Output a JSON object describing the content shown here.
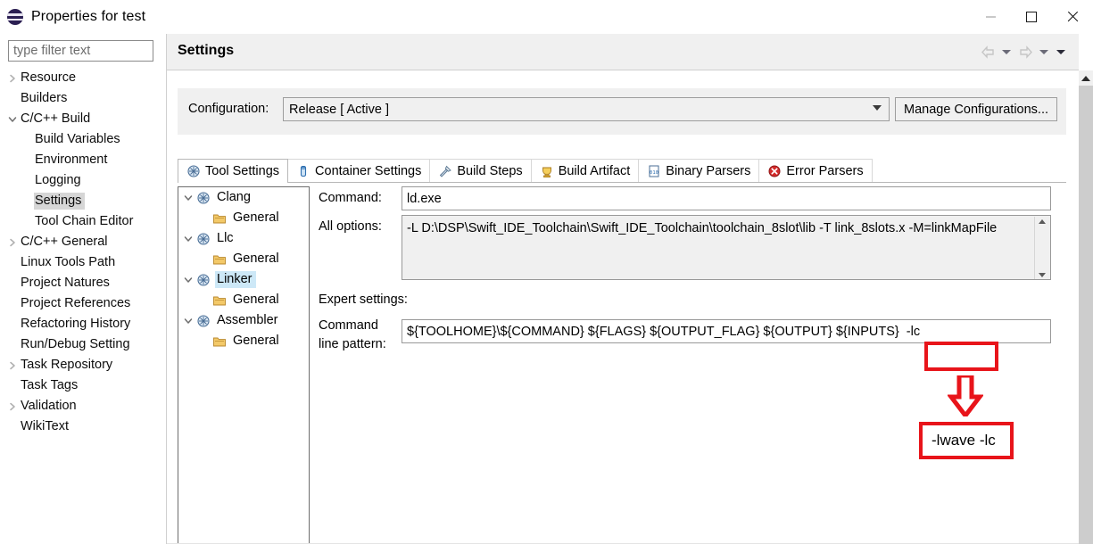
{
  "window": {
    "title": "Properties for test",
    "icon": "eclipse-icon",
    "controls": {
      "minimize": "—",
      "maximize": "☐",
      "close": "✕"
    }
  },
  "filter": {
    "placeholder": "type filter text",
    "value": ""
  },
  "sidebar": {
    "items": [
      {
        "label": "Resource",
        "indent": 0,
        "arrow": "collapsed",
        "selected": false
      },
      {
        "label": "Builders",
        "indent": 0,
        "arrow": "none",
        "selected": false
      },
      {
        "label": "C/C++ Build",
        "indent": 0,
        "arrow": "expanded",
        "selected": false
      },
      {
        "label": "Build Variables",
        "indent": 1,
        "arrow": "none",
        "selected": false
      },
      {
        "label": "Environment",
        "indent": 1,
        "arrow": "none",
        "selected": false
      },
      {
        "label": "Logging",
        "indent": 1,
        "arrow": "none",
        "selected": false
      },
      {
        "label": "Settings",
        "indent": 1,
        "arrow": "none",
        "selected": true
      },
      {
        "label": "Tool Chain Editor",
        "indent": 1,
        "arrow": "none",
        "selected": false
      },
      {
        "label": "C/C++ General",
        "indent": 0,
        "arrow": "collapsed",
        "selected": false
      },
      {
        "label": "Linux Tools Path",
        "indent": 0,
        "arrow": "none",
        "selected": false
      },
      {
        "label": "Project Natures",
        "indent": 0,
        "arrow": "none",
        "selected": false
      },
      {
        "label": "Project References",
        "indent": 0,
        "arrow": "none",
        "selected": false
      },
      {
        "label": "Refactoring History",
        "indent": 0,
        "arrow": "none",
        "selected": false
      },
      {
        "label": "Run/Debug Setting",
        "indent": 0,
        "arrow": "none",
        "selected": false
      },
      {
        "label": "Task Repository",
        "indent": 0,
        "arrow": "collapsed",
        "selected": false
      },
      {
        "label": "Task Tags",
        "indent": 0,
        "arrow": "none",
        "selected": false
      },
      {
        "label": "Validation",
        "indent": 0,
        "arrow": "collapsed",
        "selected": false
      },
      {
        "label": "WikiText",
        "indent": 0,
        "arrow": "none",
        "selected": false
      }
    ]
  },
  "header": {
    "title": "Settings",
    "nav": {
      "back": "back-arrow",
      "back_menu": "back-dropdown",
      "forward": "forward-arrow",
      "forward_menu": "forward-dropdown",
      "view_menu": "view-menu-dropdown"
    }
  },
  "configuration": {
    "label": "Configuration:",
    "value": "Release  [ Active ]",
    "manage_button": "Manage Configurations..."
  },
  "tabs": [
    {
      "label": "Tool Settings",
      "icon": "tool-settings-icon",
      "active": true
    },
    {
      "label": "Container Settings",
      "icon": "container-icon",
      "active": false
    },
    {
      "label": "Build Steps",
      "icon": "build-steps-icon",
      "active": false
    },
    {
      "label": "Build Artifact",
      "icon": "build-artifact-icon",
      "active": false
    },
    {
      "label": "Binary Parsers",
      "icon": "binary-parsers-icon",
      "active": false
    },
    {
      "label": "Error Parsers",
      "icon": "error-parsers-icon",
      "active": false
    }
  ],
  "tool_tree": [
    {
      "label": "Clang",
      "indent": 0,
      "arrow": "expanded",
      "icon": "tool-icon",
      "selected": false
    },
    {
      "label": "General",
      "indent": 1,
      "arrow": "none",
      "icon": "folder-icon",
      "selected": false
    },
    {
      "label": "Llc",
      "indent": 0,
      "arrow": "expanded",
      "icon": "tool-icon",
      "selected": false
    },
    {
      "label": "General",
      "indent": 1,
      "arrow": "none",
      "icon": "folder-icon",
      "selected": false
    },
    {
      "label": "Linker",
      "indent": 0,
      "arrow": "expanded",
      "icon": "tool-icon",
      "selected": true
    },
    {
      "label": "General",
      "indent": 1,
      "arrow": "none",
      "icon": "folder-icon",
      "selected": false
    },
    {
      "label": "Assembler",
      "indent": 0,
      "arrow": "expanded",
      "icon": "tool-icon",
      "selected": false
    },
    {
      "label": "General",
      "indent": 1,
      "arrow": "none",
      "icon": "folder-icon",
      "selected": false
    }
  ],
  "fields": {
    "command_label": "Command:",
    "command_value": "ld.exe",
    "all_options_label": "All options:",
    "all_options_value": "-L D:\\DSP\\Swift_IDE_Toolchain\\Swift_IDE_Toolchain\\toolchain_8slot\\lib -T link_8slots.x -M=linkMapFile",
    "expert_settings_label": "Expert settings:",
    "pattern_label_line1": "Command",
    "pattern_label_line2": "line pattern:",
    "pattern_value": "${TOOLHOME}\\${COMMAND} ${FLAGS} ${OUTPUT_FLAG} ${OUTPUT} ${INPUTS}  -lc"
  },
  "annotation": {
    "highlight_target": "-lc",
    "callout_text": "-lwave -lc",
    "color": "#e8141a",
    "arrow": "down-arrow"
  }
}
